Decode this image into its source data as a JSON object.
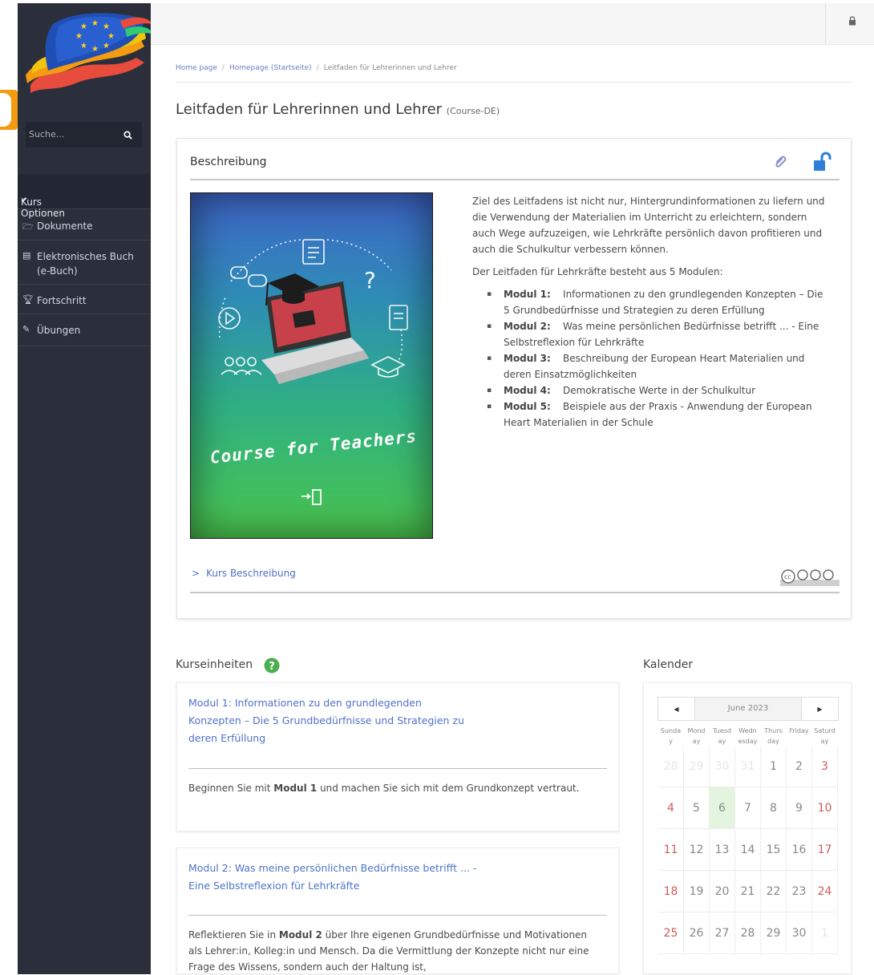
{
  "sidebar": {
    "search_placeholder": "Suche...",
    "section_title": "Kurs Optionen",
    "items": [
      {
        "icon": "folder-icon",
        "label": "Dokumente"
      },
      {
        "icon": "book-icon",
        "label": "Elektronisches Buch (e-Buch)"
      },
      {
        "icon": "trophy-icon",
        "label": "Fortschritt"
      },
      {
        "icon": "edit-icon",
        "label": "Übungen"
      }
    ]
  },
  "breadcrumb": {
    "items": [
      "Home page",
      "Homepage (Startseite)",
      "Leitfaden für Lehrerinnen und Lehrer"
    ]
  },
  "page": {
    "title": "Leitfaden für Lehrerinnen und Lehrer",
    "code": "(Course-DE)"
  },
  "description": {
    "heading": "Beschreibung",
    "cover_title": "Course for Teachers",
    "intro": "Ziel des Leitfadens ist nicht nur, Hintergrundinformationen zu liefern und die Verwendung der Materialien im Unterricht zu erleichtern, sondern auch Wege aufzuzeigen, wie Lehrkräfte persönlich davon profitieren und auch die Schulkultur verbessern können.",
    "modules_intro": "Der Leitfaden für Lehrkräfte besteht aus 5 Modulen:",
    "modules": [
      {
        "label": "Modul 1:",
        "text": "Informationen zu den grundlegenden Konzepten – Die 5 Grundbedürfnisse und Strategien zu deren Erfüllung"
      },
      {
        "label": "Modul 2:",
        "text": "Was meine persönlichen Bedürfnisse betrifft ... - Eine Selbstreflexion für Lehrkräfte"
      },
      {
        "label": "Modul 3:",
        "text": "Beschreibung der European Heart Materialien und deren Einsatzmöglichkeiten"
      },
      {
        "label": "Modul 4:",
        "text": "Demokratische Werte in der Schulkultur"
      },
      {
        "label": "Modul 5:",
        "text": "Beispiele aus der Praxis - Anwendung der European Heart Materialien in der Schule"
      }
    ],
    "course_link": "Kurs Beschreibung"
  },
  "units": {
    "title": "Kurseinheiten",
    "items": [
      {
        "title": "Modul 1: Informationen zu den grundlegenden Konzepten – Die 5 Grundbedürfnisse und Strategien zu deren Erfüllung",
        "desc_pre": "Beginnen Sie mit ",
        "desc_bold": "Modul 1",
        "desc_post": " und machen Sie sich mit dem Grundkonzept vertraut."
      },
      {
        "title": "Modul 2: Was meine persönlichen Bedürfnisse betrifft ... - Eine Selbstreflexion für Lehrkräfte",
        "desc_pre": "Reflektieren Sie in ",
        "desc_bold": "Modul 2",
        "desc_post": " über Ihre eigenen Grundbedürfnisse und Motivationen als Lehrer:in, Kolleg:in und Mensch. Da die Vermittlung der Konzepte nicht nur eine Frage des Wissens, sondern auch der Haltung ist,"
      }
    ]
  },
  "calendar": {
    "title": "Kalender",
    "month": "June 2023",
    "weekdays": [
      [
        "Sunda",
        "y"
      ],
      [
        "Mond",
        "ay"
      ],
      [
        "Tuesd",
        "ay"
      ],
      [
        "Wedn",
        "esday"
      ],
      [
        "Thurs",
        "day"
      ],
      [
        "Friday",
        ""
      ],
      [
        "Saturd",
        "ay"
      ]
    ],
    "weeks": [
      [
        "28",
        "29",
        "30",
        "31",
        "1",
        "2",
        "3"
      ],
      [
        "4",
        "5",
        "6",
        "7",
        "8",
        "9",
        "10"
      ],
      [
        "11",
        "12",
        "13",
        "14",
        "15",
        "16",
        "17"
      ],
      [
        "18",
        "19",
        "20",
        "21",
        "22",
        "23",
        "24"
      ],
      [
        "25",
        "26",
        "27",
        "28",
        "29",
        "30",
        "1"
      ]
    ],
    "today": "6"
  },
  "colors": {
    "sidebar_bg": "#2b2f3b",
    "link": "#4f72c9",
    "weekend": "#d05a5a",
    "today_bg": "#e3f5de"
  }
}
